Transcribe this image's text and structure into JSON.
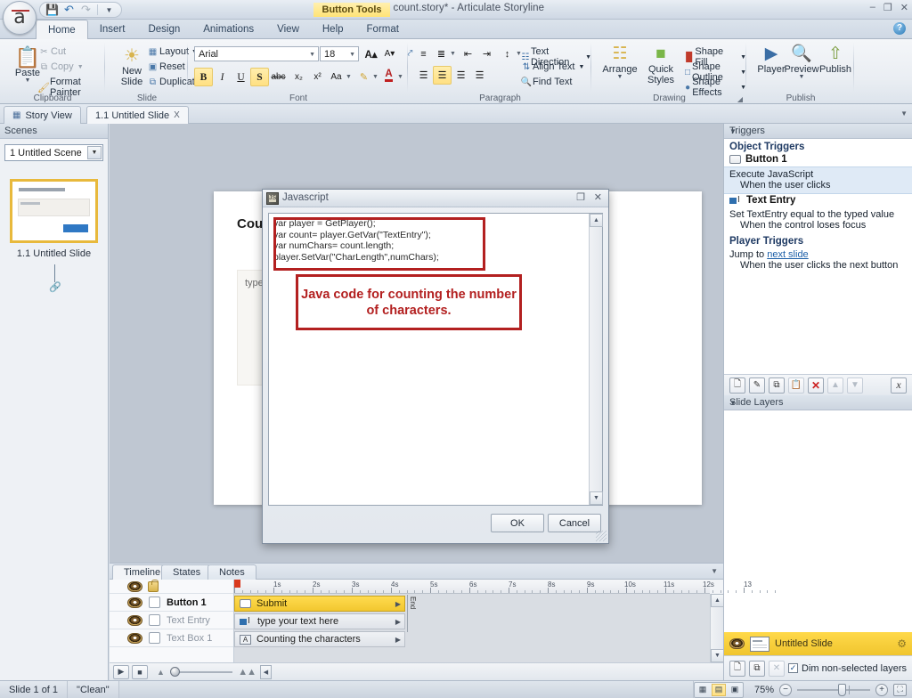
{
  "titlebar": {
    "document_title": "Char count.story* - Articulate Storyline",
    "contextual_tab": "Button Tools",
    "quick_access": [
      "save-icon",
      "undo-icon",
      "redo-icon",
      "customize-icon"
    ],
    "window_buttons": [
      "minimize",
      "restore",
      "close"
    ]
  },
  "ribbon": {
    "tabs": [
      "Home",
      "Insert",
      "Design",
      "Animations",
      "View",
      "Help",
      "Format"
    ],
    "active_tab": "Home",
    "groups": {
      "clipboard": {
        "label": "Clipboard",
        "paste": "Paste",
        "cut": "Cut",
        "copy": "Copy",
        "format_painter": "Format Painter"
      },
      "slide": {
        "label": "Slide",
        "new_slide": "New\nSlide",
        "new_slide_l1": "New",
        "new_slide_l2": "Slide",
        "layout": "Layout",
        "reset": "Reset",
        "duplicate": "Duplicate"
      },
      "font": {
        "label": "Font",
        "family": "Arial",
        "size": "18",
        "grow": "A",
        "shrink": "A",
        "clear_format": "clear-formatting-icon",
        "bold": "B",
        "italic": "I",
        "underline": "U",
        "shadow": "S",
        "strike": "abc",
        "subscript": "x₂",
        "superscript": "x²",
        "change_case": "Aa",
        "highlight": "highlight-icon",
        "font_color": "A",
        "spelling": "spelling-icon"
      },
      "paragraph": {
        "label": "Paragraph",
        "text_direction": "Text Direction",
        "align_text": "Align Text",
        "find_text": "Find Text"
      },
      "drawing": {
        "label": "Drawing",
        "arrange": "Arrange",
        "quick_styles_l1": "Quick",
        "quick_styles_l2": "Styles",
        "shape_fill": "Shape Fill",
        "shape_outline": "Shape Outline",
        "shape_effects": "Shape Effects"
      },
      "publish": {
        "label": "Publish",
        "player": "Player",
        "preview": "Preview",
        "publish": "Publish"
      }
    }
  },
  "view_tabs": {
    "story_view": "Story View",
    "slide_tab": "1.1 Untitled Slide",
    "close_label": "X"
  },
  "scenes_panel": {
    "header": "Scenes",
    "selected_scene": "1 Untitled Scene",
    "slide_caption": "1.1 Untitled Slide"
  },
  "slide": {
    "heading": "Counting the characters",
    "field_placeholder": "type your text here"
  },
  "dialog": {
    "title": "Javascript",
    "code": "var player = GetPlayer();\nvar count= player.GetVar(\"TextEntry\");\nvar numChars= count.length;\nplayer.SetVar(\"CharLength\",numChars);",
    "annotation": "Java code for counting the number of characters.",
    "ok": "OK",
    "cancel": "Cancel",
    "minimize": "❐",
    "close": "✕"
  },
  "triggers_panel": {
    "header": "Triggers",
    "object_triggers_label": "Object Triggers",
    "button_object": "Button 1",
    "trigger1_action": "Execute JavaScript",
    "trigger1_when": "When the user clicks",
    "text_entry_object": "Text Entry",
    "trigger2_action": "Set TextEntry equal to the typed value",
    "trigger2_when": "When the control loses focus",
    "player_triggers_label": "Player Triggers",
    "trigger3_action_pre": "Jump to",
    "trigger3_action_link": "next slide",
    "trigger3_when": "When the user clicks the next button",
    "toolbar_icons": [
      "new-trigger-icon",
      "edit-trigger-icon",
      "copy-trigger-icon",
      "paste-trigger-icon",
      "delete-trigger-icon",
      "move-up-icon",
      "move-down-icon",
      "javascript-icon"
    ]
  },
  "slide_layers_panel": {
    "header": "Slide Layers",
    "selected_layer": "Untitled Slide",
    "dim_checkbox_label": "Dim non-selected layers",
    "dim_checked": true
  },
  "timeline_panel": {
    "tabs": [
      "Timeline",
      "States",
      "Notes"
    ],
    "active_tab": "Timeline",
    "rows": [
      {
        "name": "Button 1",
        "bar_label": "Submit",
        "selected": true,
        "icon": "button-icon"
      },
      {
        "name": "Text Entry",
        "bar_label": "type your text here",
        "selected": false,
        "icon": "text-entry-icon"
      },
      {
        "name": "Text Box 1",
        "bar_label": "Counting the characters",
        "selected": false,
        "icon": "text-box-icon"
      }
    ],
    "ruler_labels": [
      "1s",
      "2s",
      "3s",
      "4s",
      "5s",
      "6s",
      "7s",
      "8s",
      "9s",
      "10s",
      "11s",
      "12s",
      "13"
    ],
    "end_marker": "End"
  },
  "status_bar": {
    "slide_counter": "Slide 1 of 1",
    "theme": "\"Clean\"",
    "zoom": "75%",
    "zoom_out": "−",
    "zoom_in": "+",
    "view_buttons": [
      "normal-view-icon",
      "slide-view-icon",
      "form-view-icon"
    ]
  },
  "colors": {
    "accent_yellow": "#ffd94a",
    "selection_blue": "#dfeaf6",
    "annotation_red": "#b32020",
    "link_blue": "#1c5fa8",
    "canvas_gray": "#bfc7d2"
  }
}
